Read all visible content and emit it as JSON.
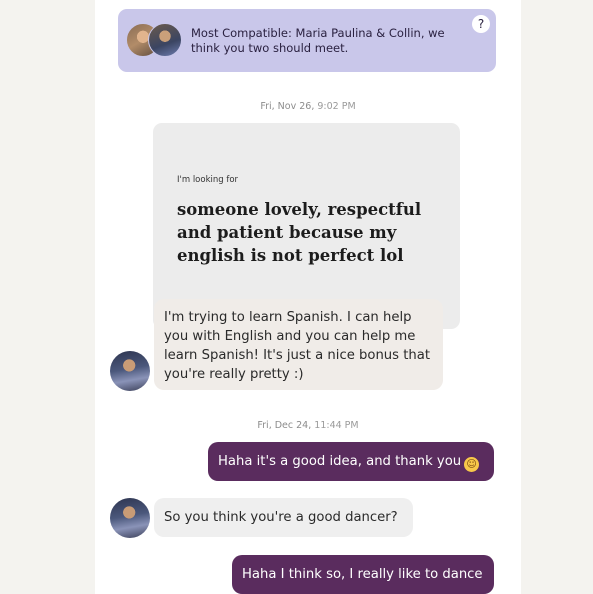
{
  "banner": {
    "text": "Most Compatible: Maria Paulina & Collin, we think you two should meet.",
    "help_label": "?"
  },
  "timestamps": [
    {
      "date": "Fri, Nov 26,",
      "time": "9:02 PM"
    },
    {
      "date": "Fri, Dec 24,",
      "time": "11:44 PM"
    }
  ],
  "prompt": {
    "label": "I'm looking for",
    "answer": "someone lovely, respectful and patient because my english is not perfect lol"
  },
  "messages": [
    {
      "direction": "incoming",
      "text": "I'm trying to learn Spanish. I can help you with English and you can help me learn Spanish! It's just a nice bonus that you're really pretty :)"
    },
    {
      "direction": "outgoing",
      "text": "Haha it's a good idea, and thank you",
      "emoji": "relieved-face"
    },
    {
      "direction": "incoming",
      "text": "So you think you're a good dancer?"
    },
    {
      "direction": "outgoing",
      "text": "Haha I think so, I really like to dance"
    }
  ],
  "colors": {
    "banner_bg": "#c9c7ea",
    "outgoing_bubble": "#5a2c5e",
    "incoming_bubble": "#f0ece8",
    "prompt_card": "#ececec"
  }
}
